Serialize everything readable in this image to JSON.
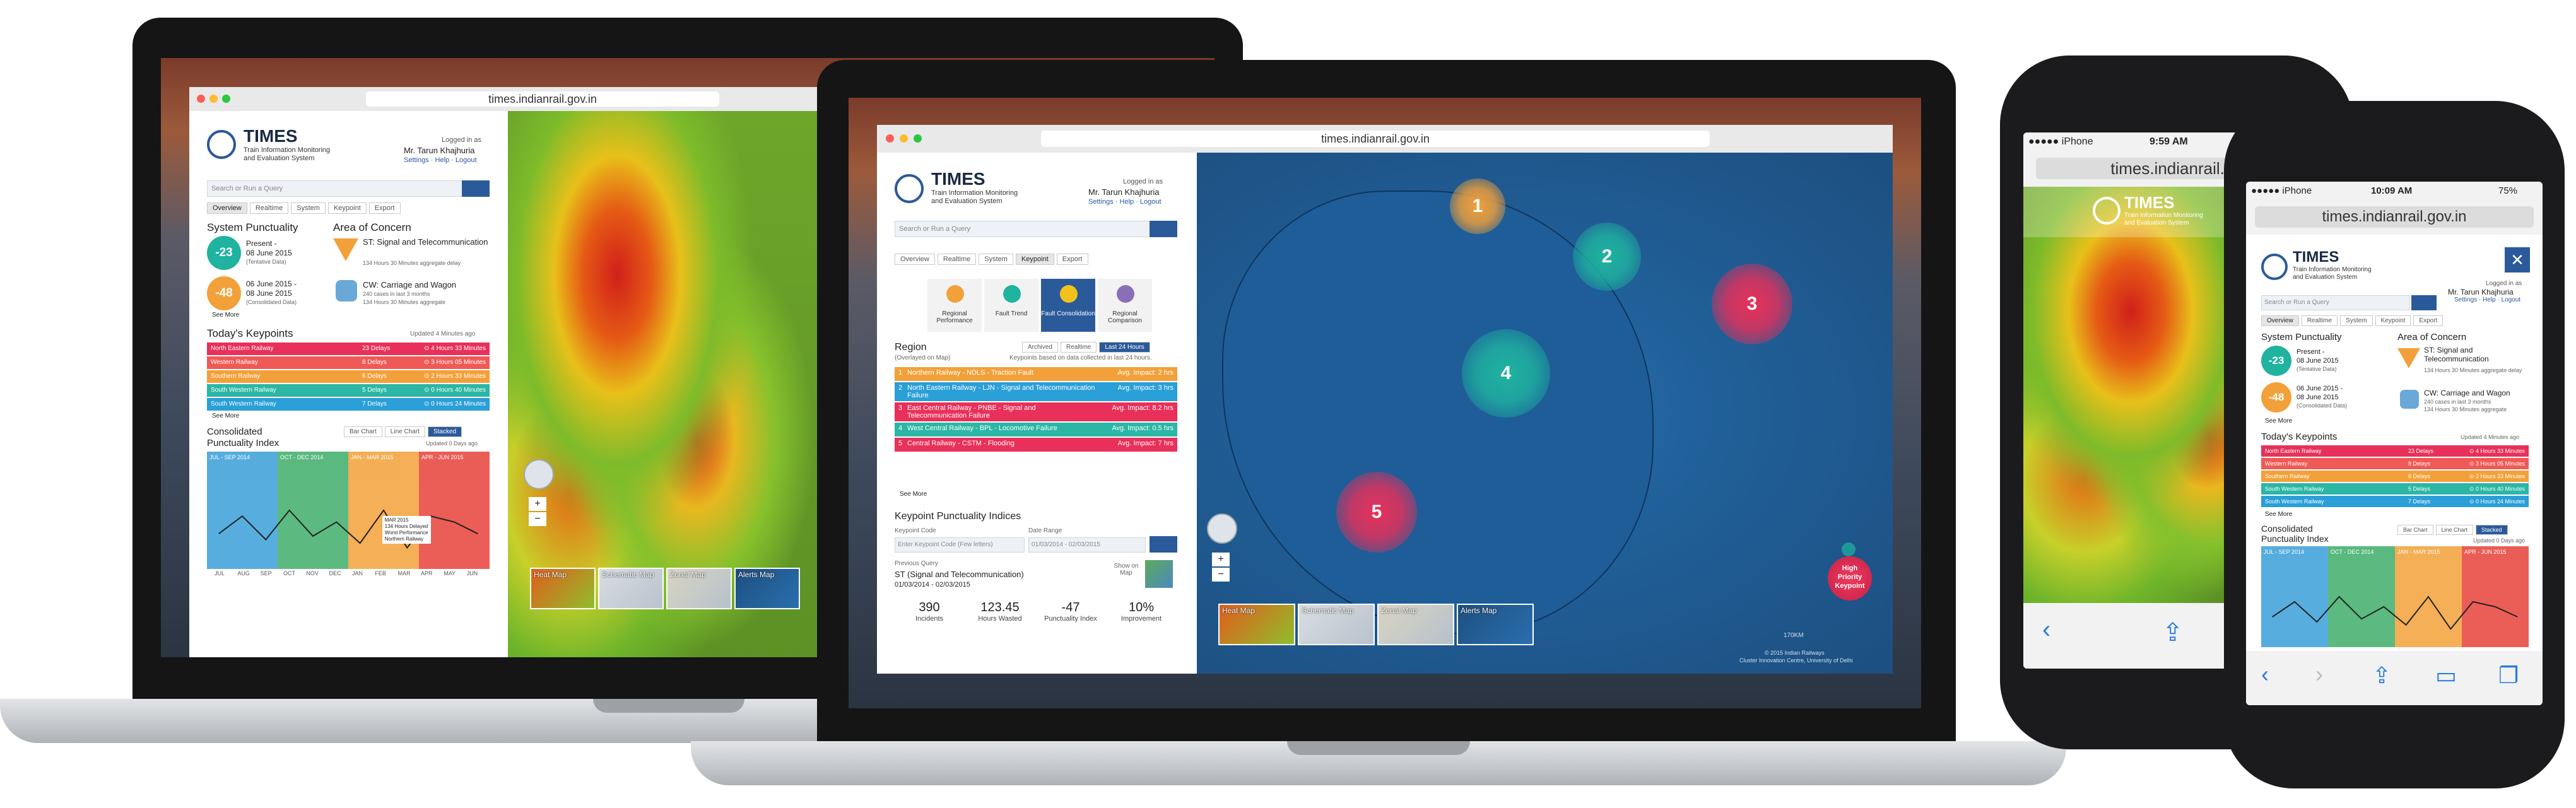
{
  "url": "times.indianrail.gov.in",
  "app": {
    "name": "TIMES",
    "subtitle_line1": "Train Information Monitoring",
    "subtitle_line2": "and Evaluation System",
    "logged_in_as": "Logged in as",
    "user": "Mr. Tarun Khajhuria",
    "links": "Settings · Help · Logout",
    "search_placeholder": "Search or Run a Query"
  },
  "tabs": [
    "Overview",
    "Realtime",
    "System",
    "Keypoint",
    "Export"
  ],
  "overview": {
    "system_punctuality": "System Punctuality",
    "area_of_concern": "Area of Concern",
    "present_value": "-23",
    "present_line1": "Present -",
    "present_line2": "08 June 2015",
    "present_note": "(Tentative Data)",
    "past_value": "-48",
    "past_line1": "06 June 2015 -",
    "past_line2": "08 June 2015",
    "past_note": "(Consolidated Data)",
    "concern1_title": "ST: Signal and Telecommunication",
    "concern1_detail": "134 Hours 30 Minutes aggregate delay",
    "concern2_title": "CW: Carriage and Wagon",
    "concern2_detail1": "240 cases in last 3 months",
    "concern2_detail2": "134 Hours 30 Minutes aggregate",
    "see_more": "See More",
    "todays_keypoints": "Today's Keypoints",
    "updated": "Updated 4 Minutes ago",
    "keypoints": [
      {
        "name": "North Eastern Railway",
        "delays": "23 Delays",
        "time": "4 Hours 33 Minutes",
        "color": "#e8305a"
      },
      {
        "name": "Western Railway",
        "delays": "8 Delays",
        "time": "3 Hours 05 Minutes",
        "color": "#ef5a56"
      },
      {
        "name": "Southern Railway",
        "delays": "6 Delays",
        "time": "2 Hours 33 Minutes",
        "color": "#f2a13a"
      },
      {
        "name": "South Western Railway",
        "delays": "5 Delays",
        "time": "0 Hours 40 Minutes",
        "color": "#2bb6a5"
      },
      {
        "name": "South Western Railway",
        "delays": "7 Delays",
        "time": "0 Hours 24 Minutes",
        "color": "#2a9fd8"
      }
    ],
    "consolidated_line1": "Consolidated",
    "consolidated_line2": "Punctuality Index",
    "chart_types": [
      "Bar Chart",
      "Line Chart",
      "Stacked"
    ],
    "updated_days": "Updated 0 Days ago",
    "periods": [
      {
        "label": "JUL - SEP 2014",
        "color": "#3aa0d8"
      },
      {
        "label": "OCT - DEC 2014",
        "color": "#3fae6a"
      },
      {
        "label": "JAN - MAR 2015",
        "color": "#f2a13a"
      },
      {
        "label": "APR - JUN 2015",
        "color": "#e8423a"
      }
    ],
    "months": [
      "JUL",
      "AUG",
      "SEP",
      "OCT",
      "NOV",
      "DEC",
      "JAN",
      "FEB",
      "MAR",
      "APR",
      "MAY",
      "JUN"
    ],
    "callout_line1": "MAR 2015",
    "callout_line2": "134 Hours Delayed",
    "callout_line3": "Worst Performance",
    "callout_line4": "Northern Railway"
  },
  "keypoint_tab": {
    "tools": [
      "Regional Performance",
      "Fault Trend",
      "Fault Consolidation",
      "Regional Comparison"
    ],
    "region": "Region",
    "overlayed": "(Overlayed on Map)",
    "region_tabs": [
      "Archived",
      "Realtime",
      "Last 24 Hours"
    ],
    "based_on": "Keypoints based on data collected in last 24 hours.",
    "rows": [
      {
        "num": "1",
        "text": "Northern Railway - NDLS - Traction Fault",
        "impact": "Avg. Impact: 2 hrs",
        "color": "#f2a13a"
      },
      {
        "num": "2",
        "text": "North Eastern Railway - LJN - Signal and Telecommunication Failure",
        "impact": "Avg. Impact: 3 hrs",
        "color": "#2a9fd8"
      },
      {
        "num": "3",
        "text": "East Central Railway - PNBE - Signal and Telecommunication Failure",
        "impact": "Avg. Impact: 8.2 hrs",
        "color": "#e8305a"
      },
      {
        "num": "4",
        "text": "West Central Railway - BPL - Locomotive Failure",
        "impact": "Avg. Impact: 0.5 hrs",
        "color": "#2bb6a5"
      },
      {
        "num": "5",
        "text": "Central Railway - CSTM - Flooding",
        "impact": "Avg. Impact: 7 hrs",
        "color": "#e8305a"
      }
    ],
    "see_more": "See More",
    "kpi_title": "Keypoint Punctuality Indices",
    "keypoint_code": "Keypoint Code",
    "date_range": "Date Range",
    "code_placeholder": "Enter Keypoint Code (Few letters)",
    "date_value": "01/03/2014 - 02/03/2015",
    "previous_query": "Previous Query",
    "prev_line1": "ST (Signal and Telecommunication)",
    "prev_line2": "01/03/2014 - 02/03/2015",
    "show_on_map": "Show on Map",
    "stats": [
      {
        "value": "390",
        "label": "Incidents"
      },
      {
        "value": "123.45",
        "label": "Hours Wasted"
      },
      {
        "value": "-47",
        "label": "Punctuality Index"
      },
      {
        "value": "10%",
        "label": "Improvement"
      }
    ]
  },
  "map": {
    "clusters": [
      "1",
      "2",
      "3",
      "4",
      "5"
    ],
    "thumbs": [
      "Heat Map",
      "Schematic Map",
      "Zonal Map",
      "Alerts Map"
    ],
    "legend_line1": "High",
    "legend_line2": "Priority",
    "legend_line3": "Keypoint",
    "scale": "170KM",
    "footer1": "© 2015 Indian Railways",
    "footer2": "Cluster Innovation Centre, University of Delhi"
  },
  "phone1": {
    "carrier": "●●●●● iPhone",
    "time": "9:59 AM",
    "url": "times.indianrail.go"
  },
  "phone2": {
    "carrier": "●●●●● iPhone",
    "time": "10:09 AM",
    "battery": "75%",
    "url": "times.indianrail.gov.in"
  }
}
